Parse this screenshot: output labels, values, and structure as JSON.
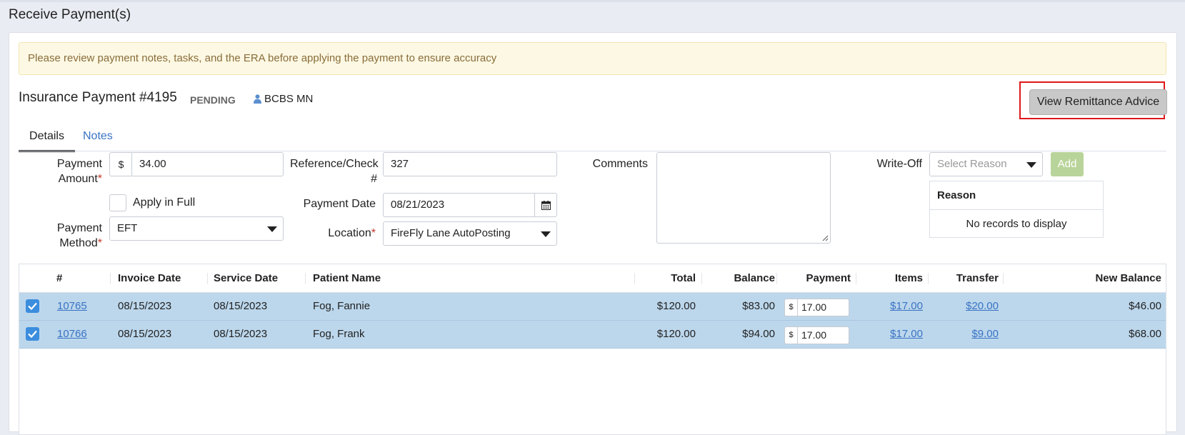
{
  "page": {
    "title": "Receive Payment(s)"
  },
  "alert": {
    "text": "Please review payment notes, tasks, and the ERA before applying the payment to ensure accuracy"
  },
  "payment": {
    "title": "Insurance Payment #4195",
    "status": "PENDING",
    "payer": "BCBS MN",
    "payer_icon": "user-icon"
  },
  "buttons": {
    "view_remittance": "View Remittance Advice",
    "add": "Add"
  },
  "tabs": [
    {
      "label": "Details",
      "active": true
    },
    {
      "label": "Notes",
      "active": false
    }
  ],
  "form": {
    "payment_amount_label": "Payment Amount",
    "currency_symbol": "$",
    "payment_amount": "34.00",
    "apply_in_full_label": "Apply in Full",
    "payment_method_label": "Payment Method",
    "payment_method": "EFT",
    "reference_label": "Reference/Check #",
    "reference": "327",
    "payment_date_label": "Payment Date",
    "payment_date": "08/21/2023",
    "location_label": "Location",
    "location": "FireFly Lane AutoPosting",
    "comments_label": "Comments",
    "writeoff_label": "Write-Off",
    "writeoff_placeholder": "Select Reason",
    "required_marker": "*"
  },
  "reason_table": {
    "header": "Reason",
    "empty": "No records to display"
  },
  "grid": {
    "columns": [
      "#",
      "Invoice Date",
      "Service Date",
      "Patient Name",
      "Total",
      "Balance",
      "Payment",
      "Items",
      "Transfer",
      "New Balance"
    ],
    "rows": [
      {
        "checked": true,
        "id": "10765",
        "invoice_date": "08/15/2023",
        "service_date": "08/15/2023",
        "patient": "Fog, Fannie",
        "total": "$120.00",
        "balance": "$83.00",
        "payment": "17.00",
        "items": "$17.00",
        "transfer": "$20.00",
        "new_balance": "$46.00"
      },
      {
        "checked": true,
        "id": "10766",
        "invoice_date": "08/15/2023",
        "service_date": "08/15/2023",
        "patient": "Fog, Frank",
        "total": "$120.00",
        "balance": "$94.00",
        "payment": "17.00",
        "items": "$17.00",
        "transfer": "$9.00",
        "new_balance": "$68.00"
      }
    ]
  },
  "colors": {
    "accent_link": "#3a73c4",
    "row_selected": "#bcd7ec",
    "alert_bg": "#fcf8e3",
    "highlight_frame": "#e0161b",
    "add_disabled": "#b9d49a"
  }
}
